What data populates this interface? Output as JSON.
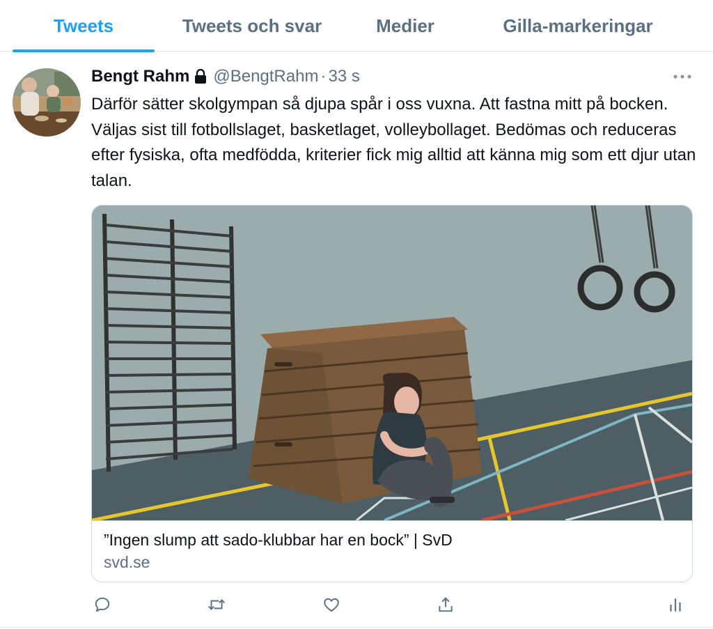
{
  "tabs": [
    {
      "label": "Tweets",
      "active": true
    },
    {
      "label": "Tweets och svar",
      "active": false
    },
    {
      "label": "Medier",
      "active": false
    },
    {
      "label": "Gilla-markeringar",
      "active": false
    }
  ],
  "tweet": {
    "display_name": "Bengt Rahm",
    "handle": "@BengtRahm",
    "separator": "·",
    "time": "33 s",
    "text": "Därför sätter skolgympan så djupa spår i oss vuxna. Att fastna mitt på bocken. Väljas sist till fotbollslaget, basketlaget, volleybollaget. Bedömas och reduceras efter fysiska, ofta medfödda, kriterier fick mig alltid att känna mig som ett djur utan talan.",
    "card": {
      "title": "”Ingen slump att sado-klubbar har en bock” | SvD",
      "domain": "svd.se"
    }
  },
  "icons": {
    "lock": "lock-icon",
    "more": "more-icon",
    "reply": "reply-icon",
    "retweet": "retweet-icon",
    "like": "like-icon",
    "share": "share-icon",
    "analytics": "analytics-icon"
  },
  "colors": {
    "accent": "#1da1f2",
    "secondary_text": "#5b7083",
    "border": "#cfd9de"
  }
}
